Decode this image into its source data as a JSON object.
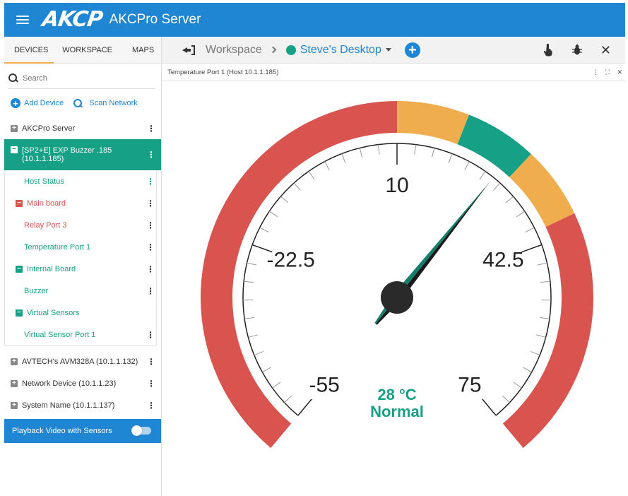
{
  "app": {
    "title": "AKCPro Server",
    "logo_text": "AKCP",
    "brand_color": "#1f86d4",
    "menu_icon": "hamburger-icon"
  },
  "sidebar": {
    "tabs": [
      "DEVICES",
      "WORKSPACE",
      "MAPS"
    ],
    "active_tab": "DEVICES",
    "search_placeholder": "Search",
    "add_device": "Add Device",
    "scan_network": "Scan Network",
    "tree": {
      "server": "AKCPro Server",
      "selected_device_line1": "[SP2+E] EXP Buzzer .185",
      "selected_device_line2": "(10.1.1.185)",
      "host_status": "Host Status",
      "main_board": "Main board",
      "relay_port": "Relay Port 3",
      "temperature_port": "Temperature Port 1",
      "internal_board": "Internal Board",
      "buzzer": "Buzzer",
      "virtual_sensors": "Virtual Sensors",
      "virtual_sensor_port": "Virtual Sensor Port 1",
      "avtech": "AVTECH's AVM328A (10.1.1.132)",
      "network_device": "Network Device (10.1.1.23)",
      "system_name": "System Name (10.1.1.137)"
    },
    "playback_label": "Playback Video with Sensors",
    "playback_enabled": false
  },
  "workspace": {
    "breadcrumb_root": "Workspace",
    "desktop_name": "Steve's Desktop",
    "status_color": "#16a085"
  },
  "panel": {
    "title": "Temperature Port 1 (Host 10.1.1.185)"
  },
  "gauge": {
    "min": -55,
    "max": 75,
    "labels": [
      "-55",
      "-22.5",
      "10",
      "42.5",
      "75"
    ],
    "value": 28,
    "reading": "28 °C",
    "status": "Normal",
    "bands": [
      {
        "from": -55,
        "to": 10,
        "color": "#d9534f"
      },
      {
        "from": 10,
        "to": 20,
        "color": "#f0ad4e"
      },
      {
        "from": 20,
        "to": 30,
        "color": "#16a085"
      },
      {
        "from": 30,
        "to": 40,
        "color": "#f0ad4e"
      },
      {
        "from": 40,
        "to": 75,
        "color": "#d9534f"
      }
    ]
  }
}
